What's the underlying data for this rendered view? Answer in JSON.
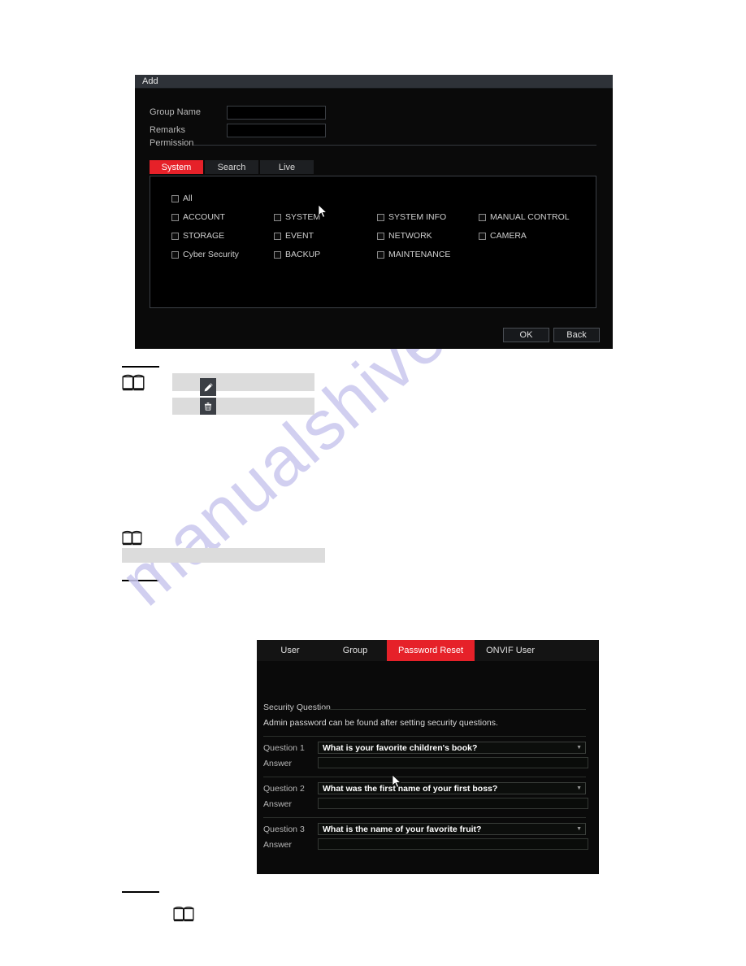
{
  "page": {
    "watermark": "manualshive.com"
  },
  "add_dialog": {
    "title": "Add",
    "group_name_label": "Group Name",
    "group_name_value": "",
    "remarks_label": "Remarks",
    "remarks_value": "",
    "permission_label": "Permission",
    "tabs": [
      {
        "label": "System",
        "active": true
      },
      {
        "label": "Search",
        "active": false
      },
      {
        "label": "Live",
        "active": false
      }
    ],
    "permissions": {
      "select_all_label": "All",
      "items": [
        "ACCOUNT",
        "SYSTEM",
        "SYSTEM INFO",
        "MANUAL CONTROL",
        "STORAGE",
        "EVENT",
        "NETWORK",
        "CAMERA",
        "Cyber Security",
        "BACKUP",
        "MAINTENANCE"
      ]
    },
    "ok_label": "OK",
    "back_label": "Back"
  },
  "note_rows": {
    "edit_icon": "pencil-icon",
    "delete_icon": "trash-icon"
  },
  "password_dialog": {
    "tabs": [
      {
        "label": "User",
        "active": false
      },
      {
        "label": "Group",
        "active": false
      },
      {
        "label": "Password Reset",
        "active": true
      },
      {
        "label": "ONVIF User",
        "active": false
      }
    ],
    "section_title": "Security Question",
    "description": "Admin password can be found after setting security questions.",
    "answer_label": "Answer",
    "questions": [
      {
        "label": "Question 1",
        "value": "What is your favorite children's book?",
        "answer": ""
      },
      {
        "label": "Question 2",
        "value": "What was the first name of your first boss?",
        "answer": ""
      },
      {
        "label": "Question 3",
        "value": "What is the name of your favorite fruit?",
        "answer": ""
      }
    ]
  },
  "colors": {
    "accent_red": "#e62129",
    "dialog_bg": "#0a0a0a",
    "titlebar_bg": "#2e3238",
    "gray_bar": "#dcdcdc",
    "watermark": "#c9c7ee"
  }
}
